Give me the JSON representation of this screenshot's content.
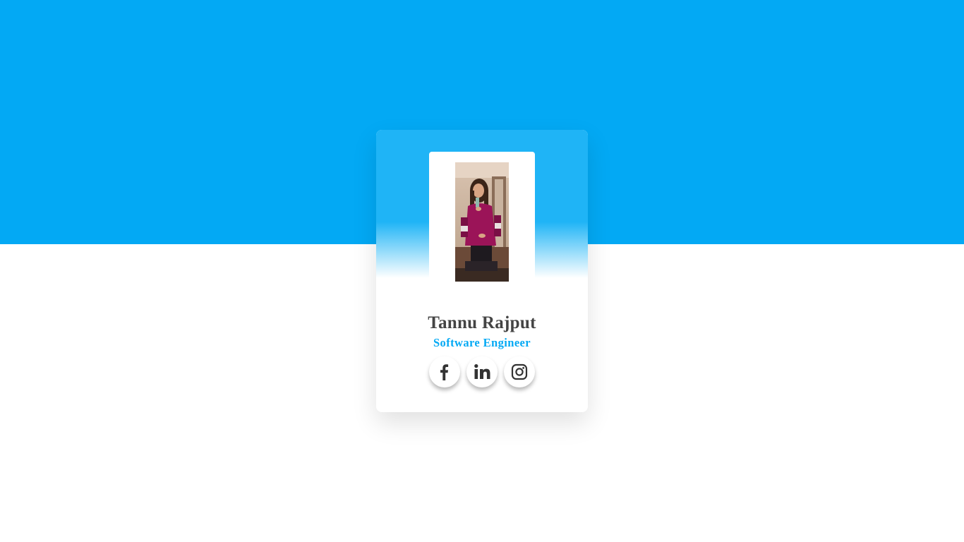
{
  "profile": {
    "name": "Tannu Rajput",
    "title": "Software Engineer",
    "photo_alt": "Mirror selfie photo"
  },
  "socials": [
    {
      "network": "facebook",
      "icon": "facebook-icon"
    },
    {
      "network": "linkedin",
      "icon": "linkedin-icon"
    },
    {
      "network": "instagram",
      "icon": "instagram-icon"
    }
  ],
  "colors": {
    "accent": "#03a9f4",
    "card_top": "#1fb4f6",
    "name_text": "#444444",
    "icon": "#333333"
  }
}
